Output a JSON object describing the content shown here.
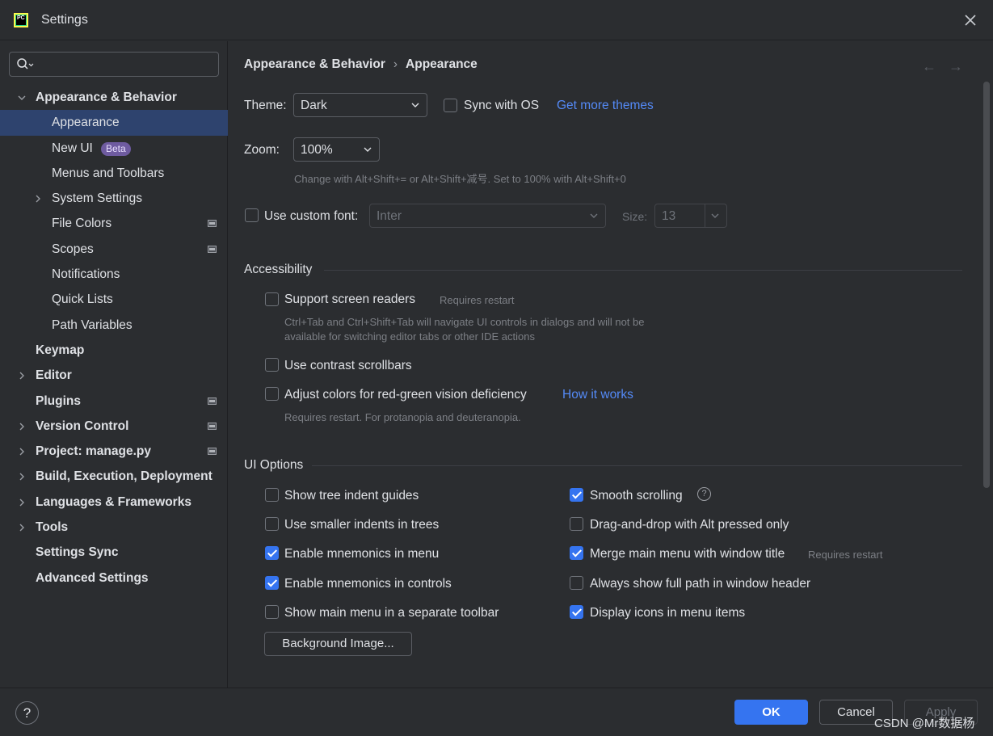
{
  "window": {
    "title": "Settings",
    "logo_text": "PC"
  },
  "search": {
    "placeholder": "",
    "value": ""
  },
  "sidebar": {
    "items": [
      {
        "label": "Appearance & Behavior",
        "level": 0,
        "expanded": true
      },
      {
        "label": "Appearance",
        "level": 1,
        "selected": true
      },
      {
        "label": "New UI",
        "level": 1,
        "badge": "Beta"
      },
      {
        "label": "Menus and Toolbars",
        "level": 1
      },
      {
        "label": "System Settings",
        "level": 1,
        "collapsed": true
      },
      {
        "label": "File Colors",
        "level": 1,
        "project_icon": true
      },
      {
        "label": "Scopes",
        "level": 1,
        "project_icon": true
      },
      {
        "label": "Notifications",
        "level": 1
      },
      {
        "label": "Quick Lists",
        "level": 1
      },
      {
        "label": "Path Variables",
        "level": 1
      },
      {
        "label": "Keymap",
        "level": 0
      },
      {
        "label": "Editor",
        "level": 0,
        "collapsed": true
      },
      {
        "label": "Plugins",
        "level": 0,
        "project_icon": true
      },
      {
        "label": "Version Control",
        "level": 0,
        "collapsed": true,
        "project_icon": true
      },
      {
        "label": "Project: manage.py",
        "level": 0,
        "collapsed": true,
        "project_icon": true
      },
      {
        "label": "Build, Execution, Deployment",
        "level": 0,
        "collapsed": true
      },
      {
        "label": "Languages & Frameworks",
        "level": 0,
        "collapsed": true
      },
      {
        "label": "Tools",
        "level": 0,
        "collapsed": true
      },
      {
        "label": "Settings Sync",
        "level": 0
      },
      {
        "label": "Advanced Settings",
        "level": 0
      }
    ]
  },
  "breadcrumb": {
    "parent": "Appearance & Behavior",
    "separator": "›",
    "current": "Appearance"
  },
  "appearance": {
    "theme_label": "Theme:",
    "theme_value": "Dark",
    "sync_os_label": "Sync with OS",
    "sync_os_checked": false,
    "more_themes_link": "Get more themes",
    "zoom_label": "Zoom:",
    "zoom_value": "100%",
    "zoom_hint": "Change with Alt+Shift+= or Alt+Shift+减号. Set to 100% with Alt+Shift+0",
    "custom_font_label": "Use custom font:",
    "custom_font_checked": false,
    "font_value": "Inter",
    "size_label": "Size:",
    "size_value": "13"
  },
  "accessibility": {
    "title": "Accessibility",
    "screen_readers_label": "Support screen readers",
    "screen_readers_hint": "Requires restart",
    "screen_readers_desc_1": "Ctrl+Tab and Ctrl+Shift+Tab will navigate UI controls in dialogs and will not be",
    "screen_readers_desc_2": "available for switching editor tabs or other IDE actions",
    "contrast_scrollbars_label": "Use contrast scrollbars",
    "color_deficiency_label": "Adjust colors for red-green vision deficiency",
    "how_it_works_link": "How it works",
    "color_deficiency_hint": "Requires restart. For protanopia and deuteranopia."
  },
  "ui_options": {
    "title": "UI Options",
    "left": [
      {
        "label": "Show tree indent guides",
        "checked": false
      },
      {
        "label": "Use smaller indents in trees",
        "checked": false
      },
      {
        "label": "Enable mnemonics in menu",
        "checked": true
      },
      {
        "label": "Enable mnemonics in controls",
        "checked": true
      },
      {
        "label": "Show main menu in a separate toolbar",
        "checked": false
      }
    ],
    "right": [
      {
        "label": "Smooth scrolling",
        "checked": true
      },
      {
        "label": "Drag-and-drop with Alt pressed only",
        "checked": false
      },
      {
        "label": "Merge main menu with window title",
        "checked": true,
        "hint": "Requires restart"
      },
      {
        "label": "Always show full path in window header",
        "checked": false
      },
      {
        "label": "Display icons in menu items",
        "checked": true
      }
    ],
    "background_image_button": "Background Image..."
  },
  "footer": {
    "help": "?",
    "ok": "OK",
    "cancel": "Cancel",
    "apply": "Apply",
    "watermark": "CSDN @Mr数据杨"
  },
  "colors": {
    "accent": "#3574f0",
    "selection": "#2e436e",
    "link": "#548af7",
    "badge": "#6e5ba0"
  }
}
